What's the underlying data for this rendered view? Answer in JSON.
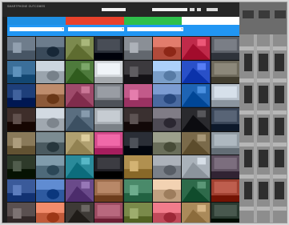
{
  "app": {
    "title": "SMARTPHONE OUTCOMES"
  },
  "topbar": {
    "fields": [
      {
        "label": "",
        "value": ""
      },
      {
        "label": "",
        "value": ""
      }
    ],
    "buttons": [
      "",
      ""
    ],
    "link": ""
  },
  "tabs": [
    {
      "label": "",
      "color": "#1f8fe3"
    },
    {
      "label": "",
      "color": "#e8412b"
    },
    {
      "label": "",
      "color": "#2fbf4b"
    },
    {
      "label": "",
      "color": "#ffffff"
    }
  ],
  "filters": [
    {
      "value": ""
    },
    {
      "value": ""
    },
    {
      "value": ""
    }
  ],
  "photos": [
    "#6f7d8c",
    "#3a4a5a",
    "#7c8a4e",
    "#2a2f38",
    "#8a8f96",
    "#b04a3a",
    "#c02a4a",
    "#5c6068",
    "#3b6f9a",
    "#9aa4ad",
    "#4e7a3c",
    "#d2d6da",
    "#3c3a3e",
    "#7a9ec8",
    "#2950c8",
    "#6e6a5c",
    "#1e3f7a",
    "#8c5a3a",
    "#9e4a6a",
    "#7b7f86",
    "#c25a8a",
    "#4a6aa0",
    "#1e64b4",
    "#b8c2cc",
    "#3e2e2a",
    "#a0a8b0",
    "#5a6e80",
    "#a8aeb4",
    "#3a3030",
    "#4e4a54",
    "#2a2a2e",
    "#3a4658",
    "#8a7a5a",
    "#4a5a60",
    "#b0a070",
    "#d24a8a",
    "#2a2e36",
    "#6a6e5a",
    "#7a6a4a",
    "#909aa2",
    "#2e3a2a",
    "#4e6a7a",
    "#2a8a9a",
    "#1e1e24",
    "#b09050",
    "#7a8088",
    "#aab2ba",
    "#5e5060",
    "#3a5a9a",
    "#2e5aa0",
    "#6a4a8a",
    "#9a6a4a",
    "#4a8a6a",
    "#c0a080",
    "#2e6a4a",
    "#a04030",
    "#5a5050",
    "#c05a3a",
    "#3e3a36",
    "#9a4a60",
    "#7a8a4a",
    "#c04a5a",
    "#aa8a5a",
    "#2a3a30"
  ],
  "colors": {
    "accent": "#2196f3",
    "background": "#1e1e1e"
  }
}
